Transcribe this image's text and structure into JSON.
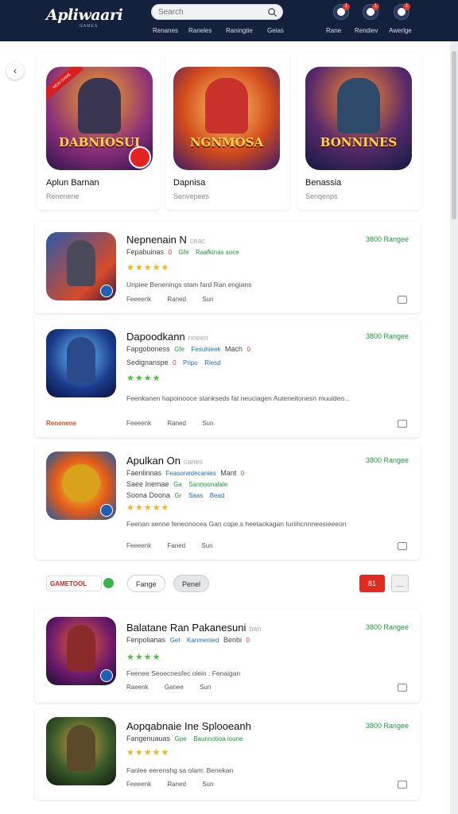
{
  "header": {
    "logo": "Apliwaari",
    "logo_sub": "GAMES",
    "search_placeholder": "Search",
    "nav": [
      "Renanes",
      "Raneles",
      "Raningtie",
      "Geias"
    ],
    "icons": [
      {
        "name": "home",
        "label": "Rane",
        "badge": "1"
      },
      {
        "name": "profile",
        "label": "Rendiev",
        "badge": "1"
      },
      {
        "name": "settings",
        "label": "Awerlge",
        "badge": "1"
      }
    ]
  },
  "featured": [
    {
      "title": "Aplun Barnan",
      "sub": "Renenene",
      "art": "DABNIOSUI",
      "ribbon": "NEW GAME"
    },
    {
      "title": "Dapnisa",
      "sub": "Senvepees",
      "art": "NGNMOSA"
    },
    {
      "title": "Benassia",
      "sub": "Senqenps",
      "art": "BONNINES"
    }
  ],
  "items": [
    {
      "title": "Nepnenain N",
      "muted": "ceac",
      "price": "3800 Rangee",
      "lines": [
        [
          "Fepabuinas",
          "0",
          "Gfe",
          "Raafkinas soce"
        ]
      ],
      "stars": "★★★★★",
      "desc": "Unpiee Benenings stam fard Ran engians",
      "actions": [
        "Feeeenk",
        "Raned",
        "Sun"
      ]
    },
    {
      "title": "Dapoodkann",
      "muted": "nneen",
      "price": "3800 Rangee",
      "lines": [
        [
          "Fapgoboness",
          "Gfe",
          "Fesuhieek",
          "Mach",
          "0"
        ],
        [
          "Sedignanspe",
          "0",
          "Pripo",
          "Riesd"
        ]
      ],
      "stars": "★★★★",
      "desc": "Feenkanen hapoinooce stankseds fat neuciagen Auteneitonesn muuideo...",
      "tag": "Renenene",
      "actions": [
        "Feeeenk",
        "Raned",
        "Sun"
      ]
    },
    {
      "title": "Apulkan On",
      "muted": "canes",
      "price": "3800 Rangee",
      "lines": [
        [
          "Faenlinnas",
          "Feasonedecanies",
          "Mant",
          "0"
        ],
        [
          "Saee Inemae",
          "Ga",
          "Sannoonalale"
        ],
        [
          "Soona Doona",
          "Gr",
          "Saas",
          "Bead"
        ]
      ],
      "stars": "★★★★★",
      "desc": "Feenan senne feneonocea Gan cope.s heetackagan Iuriihcnnneesieeeon",
      "actions": [
        "Feeeenk",
        "Faned",
        "Sun"
      ]
    },
    {
      "title": "Balatane Ran Pakanesuni",
      "muted": "ban",
      "price": "3800 Rangee",
      "lines": [
        [
          "Fenpolianas",
          "Get",
          "Kanmenied",
          "Benbi",
          "0"
        ]
      ],
      "stars": "★★★★",
      "desc": "Feenee Seoecnesfec olein : Fenaigan",
      "actions": [
        "Raeenk",
        "Ganee",
        "Sun"
      ]
    },
    {
      "title": "Aopqabnaie Ine Splooeanh",
      "muted": "",
      "price": "3800 Rangee",
      "lines": [
        [
          "Fangenuauas",
          "Gpe",
          "Baunnotioa ioune"
        ]
      ],
      "stars": "★★★★★",
      "desc": "Fanlee eerenshg sa olam: Benekan",
      "actions": [
        "Feeeenk",
        "Raned",
        "Sun"
      ]
    }
  ],
  "toolbar": {
    "ad_label": "GAMETOOL",
    "buttons": [
      "Fange",
      "Penel",
      "81",
      "…"
    ]
  }
}
